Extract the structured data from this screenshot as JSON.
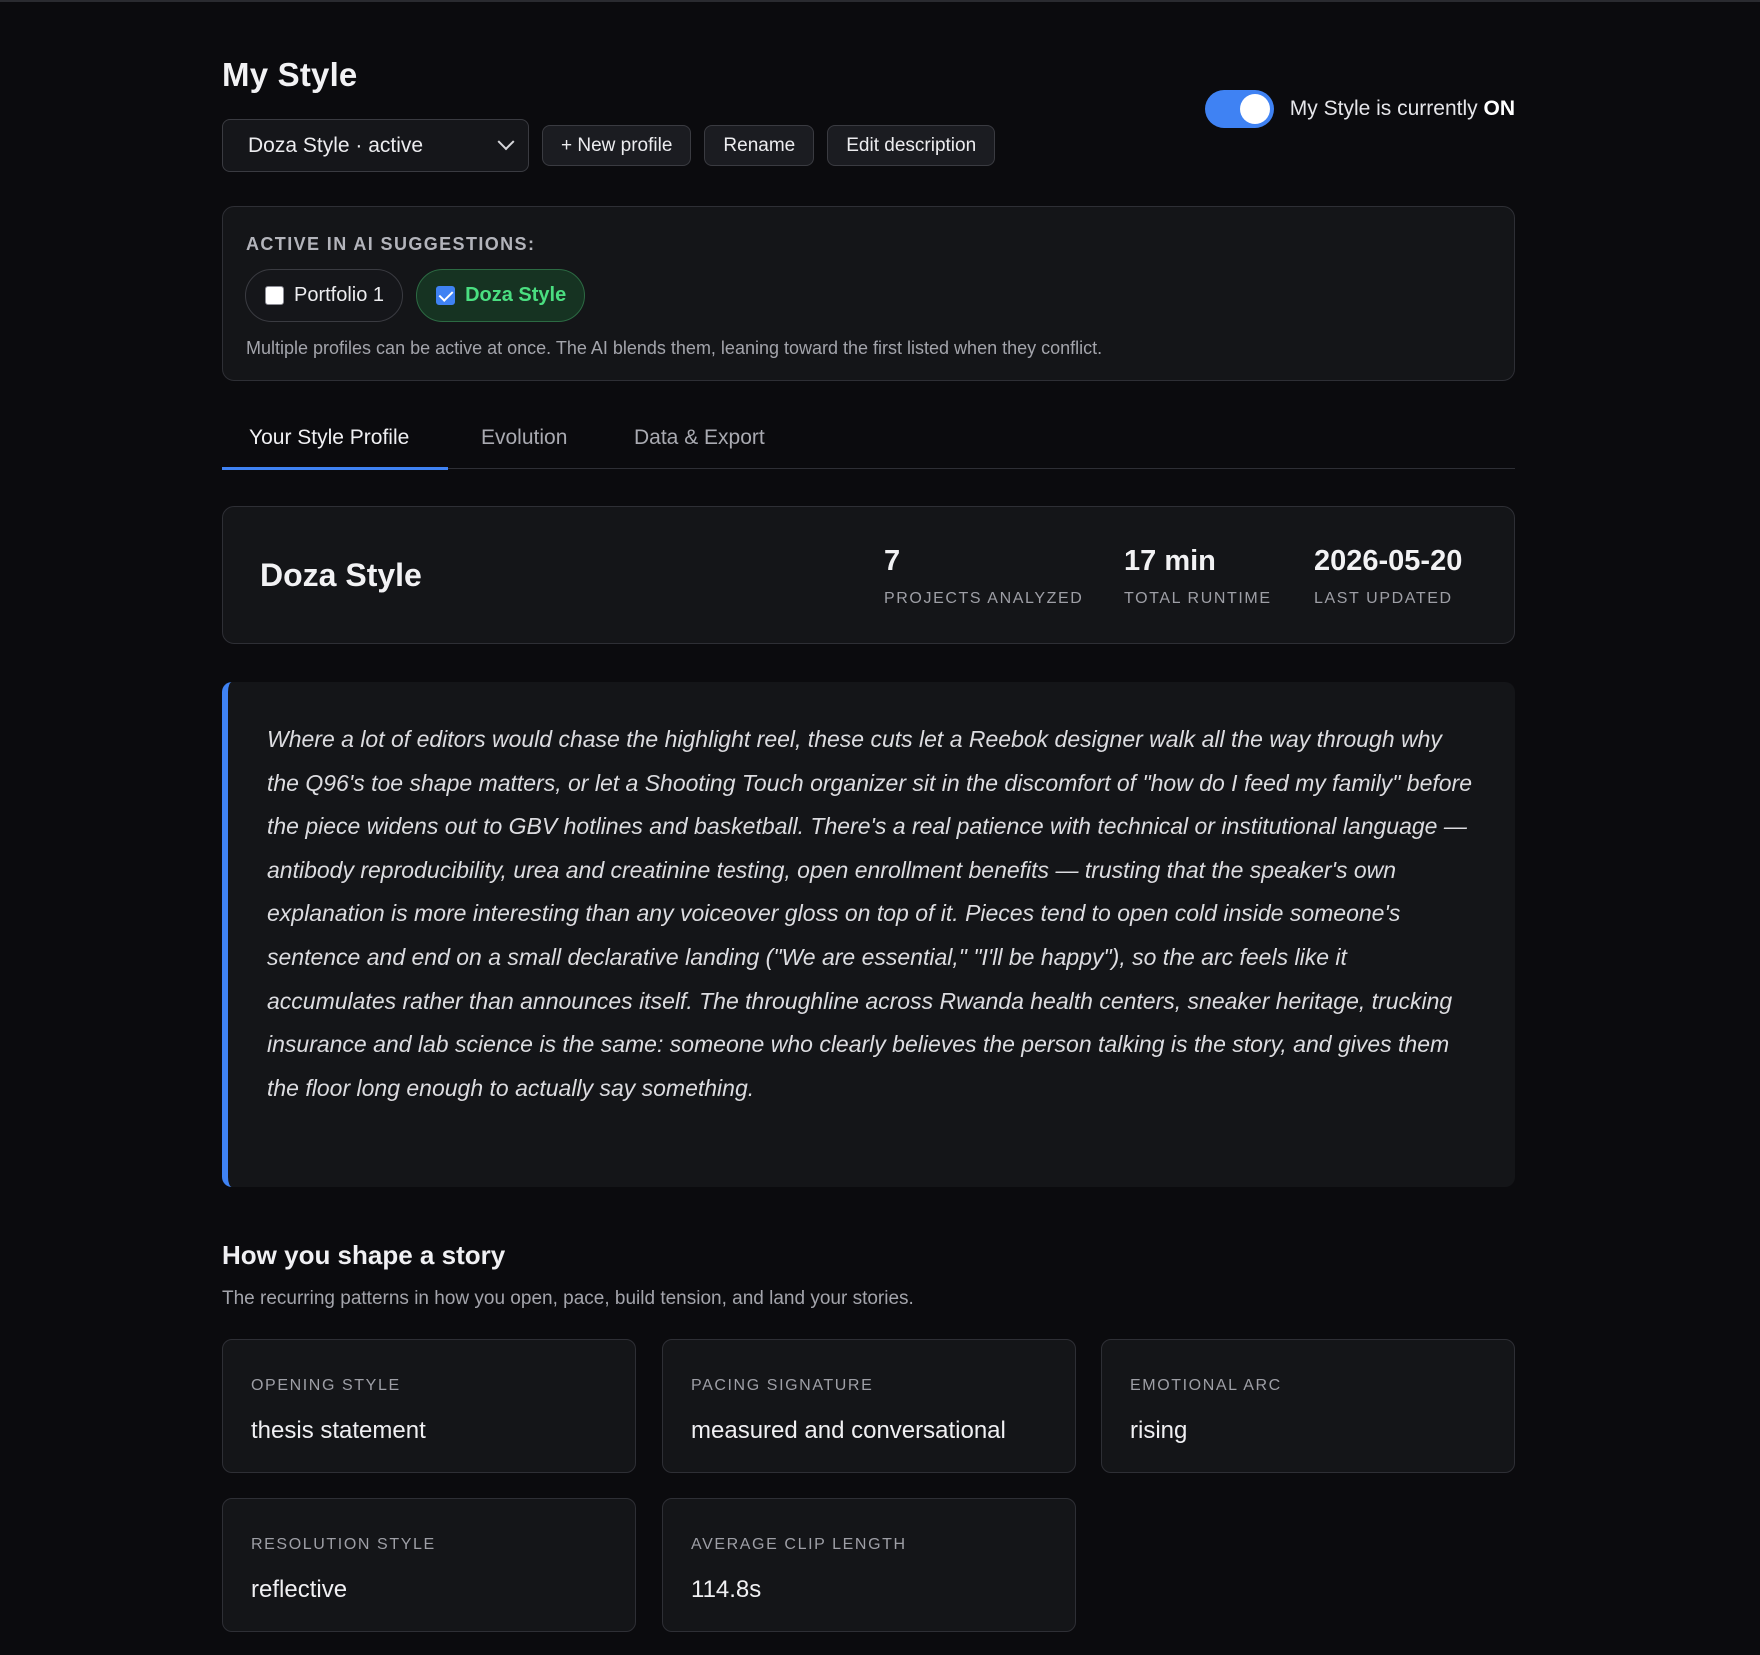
{
  "header": {
    "title": "My Style",
    "profile_select": "Doza Style · active",
    "new_profile_label": "+ New profile",
    "rename_label": "Rename",
    "edit_description_label": "Edit description",
    "toggle_text_prefix": "My Style is currently ",
    "toggle_state": "ON",
    "toggle_on": true
  },
  "suggestions": {
    "label": "ACTIVE IN AI SUGGESTIONS:",
    "chips": [
      {
        "label": "Portfolio 1",
        "checked": false
      },
      {
        "label": "Doza Style",
        "checked": true
      }
    ],
    "note": "Multiple profiles can be active at once. The AI blends them, leaning toward the first listed when they conflict."
  },
  "tabs": [
    {
      "label": "Your Style Profile",
      "selected": true
    },
    {
      "label": "Evolution",
      "selected": false
    },
    {
      "label": "Data & Export",
      "selected": false
    }
  ],
  "summary": {
    "name": "Doza Style",
    "stats": [
      {
        "value": "7",
        "label": "PROJECTS ANALYZED"
      },
      {
        "value": "17 min",
        "label": "TOTAL RUNTIME"
      },
      {
        "value": "2026-05-20",
        "label": "LAST UPDATED"
      }
    ]
  },
  "description": "Where a lot of editors would chase the highlight reel, these cuts let a Reebok designer walk all the way through why the Q96's toe shape matters, or let a Shooting Touch organizer sit in the discomfort of \"how do I feed my family\" before the piece widens out to GBV hotlines and basketball. There's a real patience with technical or institutional language — antibody reproducibility, urea and creatinine testing, open enrollment benefits — trusting that the speaker's own explanation is more interesting than any voiceover gloss on top of it. Pieces tend to open cold inside someone's sentence and end on a small declarative landing (\"We are essential,\" \"I'll be happy\"), so the arc feels like it accumulates rather than announces itself. The throughline across Rwanda health centers, sneaker heritage, trucking insurance and lab science is the same: someone who clearly believes the person talking is the story, and gives them the floor long enough to actually say something.",
  "story": {
    "title": "How you shape a story",
    "subtitle": "The recurring patterns in how you open, pace, build tension, and land your stories.",
    "cards": [
      {
        "label": "OPENING STYLE",
        "value": "thesis statement"
      },
      {
        "label": "PACING SIGNATURE",
        "value": "measured and conversational"
      },
      {
        "label": "EMOTIONAL ARC",
        "value": "rising"
      },
      {
        "label": "RESOLUTION STYLE",
        "value": "reflective"
      },
      {
        "label": "AVERAGE CLIP LENGTH",
        "value": "114.8s"
      }
    ]
  },
  "colors": {
    "accent": "#3f82f3",
    "active_chip_text": "#4ade80",
    "background": "#0b0b0e"
  }
}
